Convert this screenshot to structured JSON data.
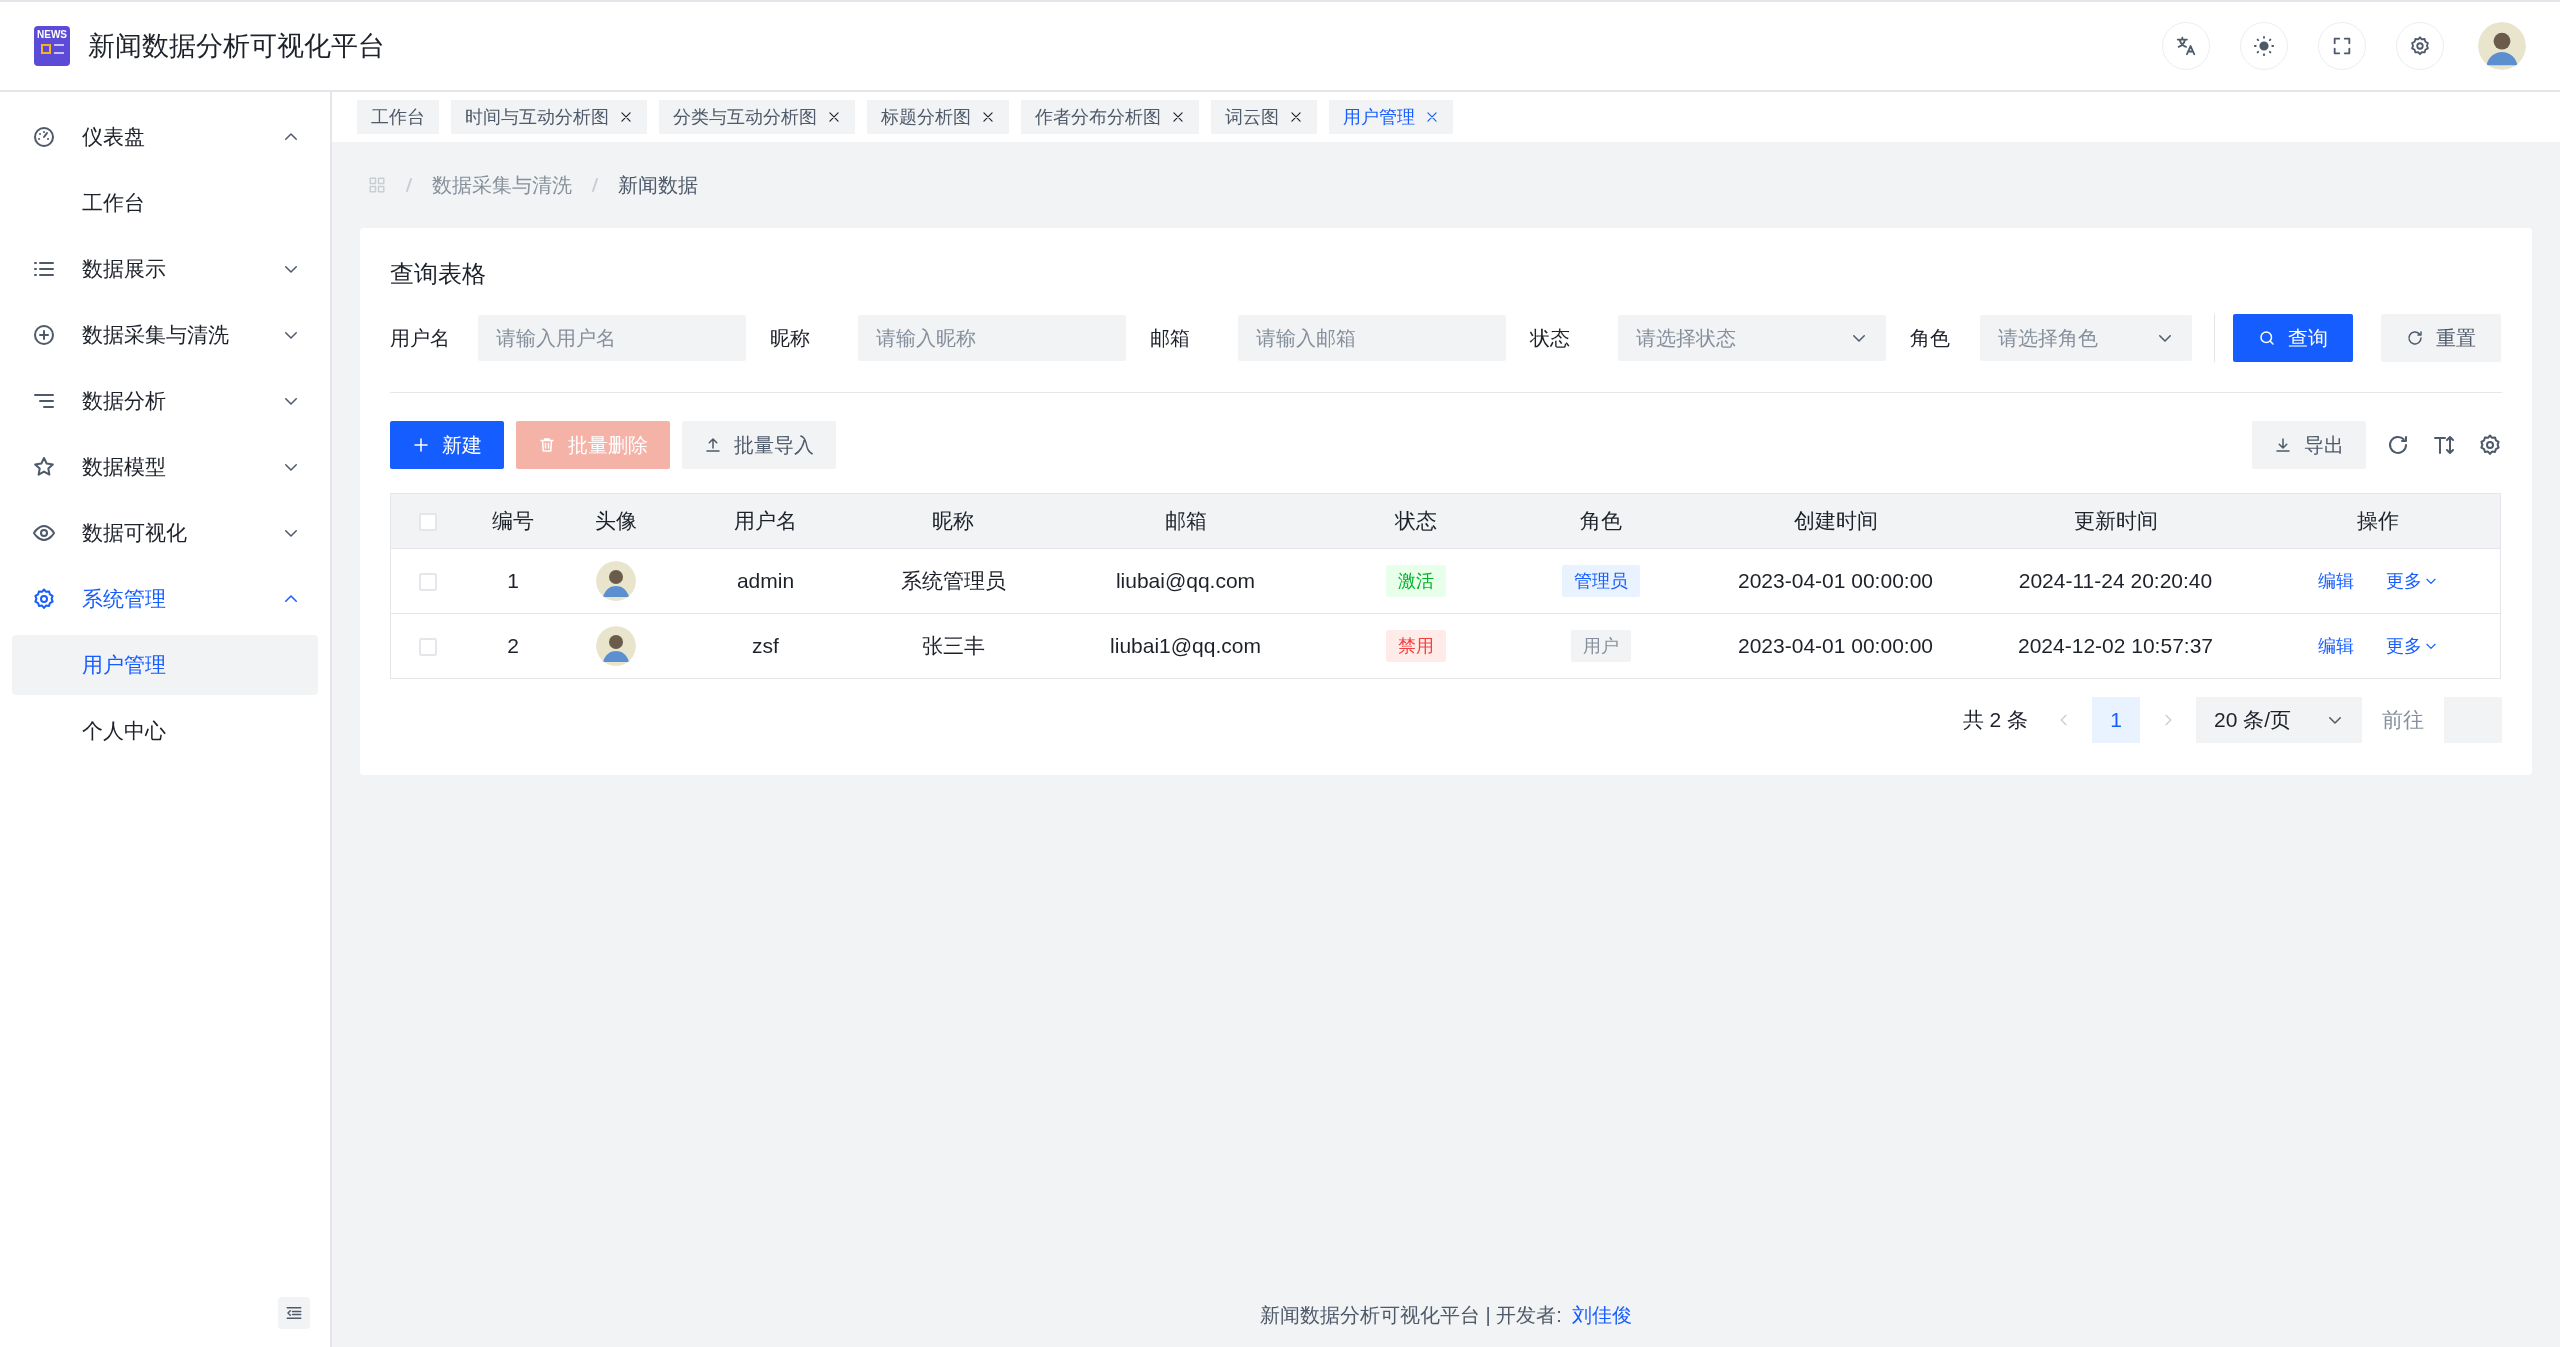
{
  "header": {
    "logo_text": "NEWS",
    "title": "新闻数据分析可视化平台"
  },
  "sidebar": {
    "items": [
      {
        "label": "仪表盘",
        "expanded": true,
        "selected": false,
        "children": [
          {
            "label": "工作台",
            "selected": false
          }
        ]
      },
      {
        "label": "数据展示",
        "expanded": false,
        "selected": false
      },
      {
        "label": "数据采集与清洗",
        "expanded": false,
        "selected": false
      },
      {
        "label": "数据分析",
        "expanded": false,
        "selected": false
      },
      {
        "label": "数据模型",
        "expanded": false,
        "selected": false
      },
      {
        "label": "数据可视化",
        "expanded": false,
        "selected": false
      },
      {
        "label": "系统管理",
        "expanded": true,
        "selected": true,
        "children": [
          {
            "label": "用户管理",
            "selected": true
          },
          {
            "label": "个人中心",
            "selected": false
          }
        ]
      }
    ]
  },
  "tabs": [
    {
      "label": "工作台",
      "selected": false,
      "closable": false
    },
    {
      "label": "时间与互动分析图",
      "selected": false,
      "closable": true
    },
    {
      "label": "分类与互动分析图",
      "selected": false,
      "closable": true
    },
    {
      "label": "标题分析图",
      "selected": false,
      "closable": true
    },
    {
      "label": "作者分布分析图",
      "selected": false,
      "closable": true
    },
    {
      "label": "词云图",
      "selected": false,
      "closable": true
    },
    {
      "label": "用户管理",
      "selected": true,
      "closable": true
    }
  ],
  "breadcrumb": [
    "数据采集与清洗",
    "新闻数据"
  ],
  "card": {
    "title": "查询表格",
    "filters": [
      {
        "label": "用户名",
        "placeholder": "请输入用户名",
        "kind": "input"
      },
      {
        "label": "昵称",
        "placeholder": "请输入昵称",
        "kind": "input"
      },
      {
        "label": "邮箱",
        "placeholder": "请输入邮箱",
        "kind": "input"
      },
      {
        "label": "状态",
        "placeholder": "请选择状态",
        "kind": "select"
      },
      {
        "label": "角色",
        "placeholder": "请选择角色",
        "kind": "select"
      }
    ],
    "search_buttons": [
      {
        "label": "查询",
        "kind": "primary"
      },
      {
        "label": "重置",
        "kind": "secondary"
      }
    ],
    "toolbar": [
      {
        "label": "新建",
        "kind": "primary",
        "disabled": false
      },
      {
        "label": "批量删除",
        "kind": "danger",
        "disabled": true
      },
      {
        "label": "批量导入",
        "kind": "secondary",
        "disabled": false
      }
    ],
    "export_button": {
      "label": "导出"
    },
    "table": {
      "select_all": {
        "checked": false
      },
      "columns": [
        "编号",
        "头像",
        "用户名",
        "昵称",
        "邮箱",
        "状态",
        "角色",
        "创建时间",
        "更新时间",
        "操作"
      ],
      "rows": [
        {
          "checked": false,
          "id": "1",
          "username": "admin",
          "nickname": "系统管理员",
          "email": "liubai@qq.com",
          "status": {
            "label": "激活",
            "kind": "success"
          },
          "role": {
            "label": "管理员",
            "kind": "primary"
          },
          "created": "2023-04-01 00:00:00",
          "updated": "2024-11-24 20:20:40",
          "actions": [
            {
              "label": "编辑",
              "kind": "link"
            },
            {
              "label": "更多",
              "kind": "dropdown"
            }
          ]
        },
        {
          "checked": false,
          "id": "2",
          "username": "zsf",
          "nickname": "张三丰",
          "email": "liubai1@qq.com",
          "status": {
            "label": "禁用",
            "kind": "danger"
          },
          "role": {
            "label": "用户",
            "kind": "neutral"
          },
          "created": "2023-04-01 00:00:00",
          "updated": "2024-12-02 10:57:37",
          "actions": [
            {
              "label": "编辑",
              "kind": "link"
            },
            {
              "label": "更多",
              "kind": "dropdown"
            }
          ]
        }
      ]
    },
    "pagination": {
      "total": "共 2 条",
      "pages": [
        {
          "label": "1",
          "selected": true
        }
      ],
      "page_size": "20 条/页",
      "goto_label": "前往"
    }
  },
  "footer": {
    "text": "新闻数据分析可视化平台 | 开发者:",
    "author": "刘佳俊"
  }
}
